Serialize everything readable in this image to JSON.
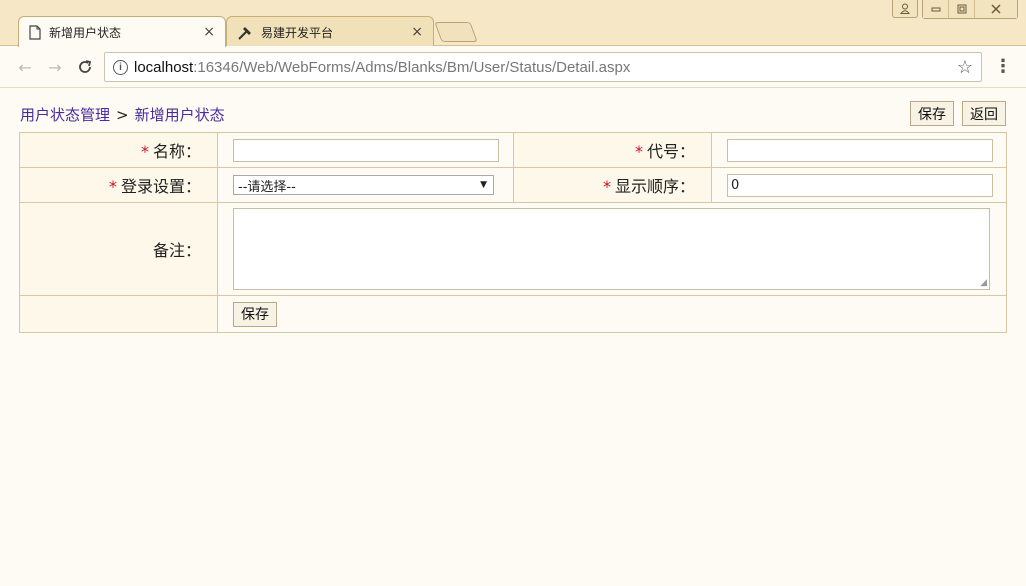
{
  "browser": {
    "tabs": [
      {
        "title": "新增用户状态",
        "icon": "page-icon"
      },
      {
        "title": "易建开发平台",
        "icon": "hammer-icon"
      }
    ],
    "tab_close": "×",
    "url_host": "localhost",
    "url_rest": ":16346/Web/WebForms/Adms/Blanks/Bm/User/Status/Detail.aspx",
    "info_glyph": "i",
    "star_glyph": "☆",
    "menu_glyph": "⋮"
  },
  "page": {
    "breadcrumb": {
      "parent": "用户状态管理",
      "separator": ">",
      "current": "新增用户状态"
    },
    "actions": {
      "save": "保存",
      "back": "返回"
    },
    "form": {
      "required_mark": "*",
      "name_label": "名称：",
      "code_label": "代号：",
      "login_label": "登录设置：",
      "login_value": "--请选择--",
      "order_label": "显示顺序：",
      "order_value": "0",
      "remark_label": "备注：",
      "save_label": "保存"
    }
  },
  "colors": {
    "accent_link": "#4b2a9e",
    "required": "#c8102e",
    "chrome": "#f6e8c6"
  }
}
